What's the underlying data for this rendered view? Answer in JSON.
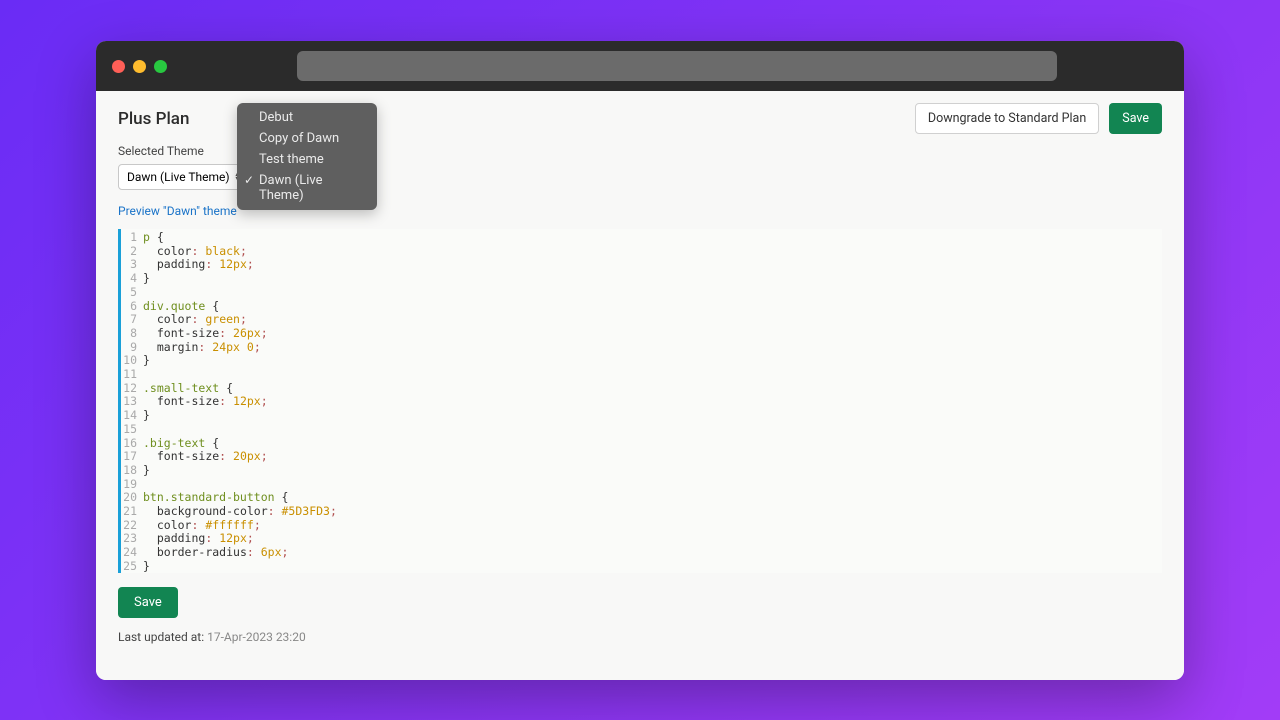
{
  "header": {
    "plan_title": "Plus Plan",
    "downgrade_label": "Downgrade to Standard Plan",
    "save_label": "Save"
  },
  "theme_picker": {
    "label": "Selected Theme",
    "selected": "Dawn (Live Theme)",
    "options": [
      "Debut",
      "Copy of Dawn",
      "Test theme",
      "Dawn (Live Theme)"
    ],
    "selected_index": 3
  },
  "preview_link": "Preview \"Dawn\" theme",
  "code": [
    {
      "n": 1,
      "t": [
        {
          "c": "tok-sel",
          "s": "p"
        },
        {
          "c": "",
          "s": " "
        },
        {
          "c": "tok-brace",
          "s": "{"
        }
      ]
    },
    {
      "n": 2,
      "t": [
        {
          "c": "",
          "s": "  "
        },
        {
          "c": "tok-prop",
          "s": "color"
        },
        {
          "c": "tok-punc",
          "s": ": "
        },
        {
          "c": "tok-val",
          "s": "black"
        },
        {
          "c": "tok-punc",
          "s": ";"
        }
      ]
    },
    {
      "n": 3,
      "t": [
        {
          "c": "",
          "s": "  "
        },
        {
          "c": "tok-prop",
          "s": "padding"
        },
        {
          "c": "tok-punc",
          "s": ": "
        },
        {
          "c": "tok-val",
          "s": "12px"
        },
        {
          "c": "tok-punc",
          "s": ";"
        }
      ]
    },
    {
      "n": 4,
      "t": [
        {
          "c": "tok-brace",
          "s": "}"
        }
      ]
    },
    {
      "n": 5,
      "t": []
    },
    {
      "n": 6,
      "t": [
        {
          "c": "tok-sel",
          "s": "div.quote"
        },
        {
          "c": "",
          "s": " "
        },
        {
          "c": "tok-brace",
          "s": "{"
        }
      ]
    },
    {
      "n": 7,
      "t": [
        {
          "c": "",
          "s": "  "
        },
        {
          "c": "tok-prop",
          "s": "color"
        },
        {
          "c": "tok-punc",
          "s": ": "
        },
        {
          "c": "tok-val",
          "s": "green"
        },
        {
          "c": "tok-punc",
          "s": ";"
        }
      ]
    },
    {
      "n": 8,
      "t": [
        {
          "c": "",
          "s": "  "
        },
        {
          "c": "tok-prop",
          "s": "font-size"
        },
        {
          "c": "tok-punc",
          "s": ": "
        },
        {
          "c": "tok-val",
          "s": "26px"
        },
        {
          "c": "tok-punc",
          "s": ";"
        }
      ]
    },
    {
      "n": 9,
      "t": [
        {
          "c": "",
          "s": "  "
        },
        {
          "c": "tok-prop",
          "s": "margin"
        },
        {
          "c": "tok-punc",
          "s": ": "
        },
        {
          "c": "tok-val",
          "s": "24px 0"
        },
        {
          "c": "tok-punc",
          "s": ";"
        }
      ]
    },
    {
      "n": 10,
      "t": [
        {
          "c": "tok-brace",
          "s": "}"
        }
      ]
    },
    {
      "n": 11,
      "t": []
    },
    {
      "n": 12,
      "t": [
        {
          "c": "tok-sel",
          "s": ".small-text"
        },
        {
          "c": "",
          "s": " "
        },
        {
          "c": "tok-brace",
          "s": "{"
        }
      ]
    },
    {
      "n": 13,
      "t": [
        {
          "c": "",
          "s": "  "
        },
        {
          "c": "tok-prop",
          "s": "font-size"
        },
        {
          "c": "tok-punc",
          "s": ": "
        },
        {
          "c": "tok-val",
          "s": "12px"
        },
        {
          "c": "tok-punc",
          "s": ";"
        }
      ]
    },
    {
      "n": 14,
      "t": [
        {
          "c": "tok-brace",
          "s": "}"
        }
      ]
    },
    {
      "n": 15,
      "t": []
    },
    {
      "n": 16,
      "t": [
        {
          "c": "tok-sel",
          "s": ".big-text"
        },
        {
          "c": "",
          "s": " "
        },
        {
          "c": "tok-brace",
          "s": "{"
        }
      ]
    },
    {
      "n": 17,
      "t": [
        {
          "c": "",
          "s": "  "
        },
        {
          "c": "tok-prop",
          "s": "font-size"
        },
        {
          "c": "tok-punc",
          "s": ": "
        },
        {
          "c": "tok-val",
          "s": "20px"
        },
        {
          "c": "tok-punc",
          "s": ";"
        }
      ]
    },
    {
      "n": 18,
      "t": [
        {
          "c": "tok-brace",
          "s": "}"
        }
      ]
    },
    {
      "n": 19,
      "t": []
    },
    {
      "n": 20,
      "t": [
        {
          "c": "tok-sel",
          "s": "btn.standard-button"
        },
        {
          "c": "",
          "s": " "
        },
        {
          "c": "tok-brace",
          "s": "{"
        }
      ]
    },
    {
      "n": 21,
      "t": [
        {
          "c": "",
          "s": "  "
        },
        {
          "c": "tok-prop",
          "s": "background-color"
        },
        {
          "c": "tok-punc",
          "s": ": "
        },
        {
          "c": "tok-val",
          "s": "#5D3FD3"
        },
        {
          "c": "tok-punc",
          "s": ";"
        }
      ]
    },
    {
      "n": 22,
      "t": [
        {
          "c": "",
          "s": "  "
        },
        {
          "c": "tok-prop",
          "s": "color"
        },
        {
          "c": "tok-punc",
          "s": ": "
        },
        {
          "c": "tok-val",
          "s": "#ffffff"
        },
        {
          "c": "tok-punc",
          "s": ";"
        }
      ]
    },
    {
      "n": 23,
      "t": [
        {
          "c": "",
          "s": "  "
        },
        {
          "c": "tok-prop",
          "s": "padding"
        },
        {
          "c": "tok-punc",
          "s": ": "
        },
        {
          "c": "tok-val",
          "s": "12px"
        },
        {
          "c": "tok-punc",
          "s": ";"
        }
      ]
    },
    {
      "n": 24,
      "t": [
        {
          "c": "",
          "s": "  "
        },
        {
          "c": "tok-prop",
          "s": "border-radius"
        },
        {
          "c": "tok-punc",
          "s": ": "
        },
        {
          "c": "tok-val",
          "s": "6px"
        },
        {
          "c": "tok-punc",
          "s": ";"
        }
      ]
    },
    {
      "n": 25,
      "t": [
        {
          "c": "tok-brace",
          "s": "}"
        }
      ]
    }
  ],
  "footer": {
    "save_label": "Save",
    "last_updated_prefix": "Last updated at: ",
    "last_updated_value": "17-Apr-2023 23:20"
  },
  "colors": {
    "accent_green": "#128552",
    "link_blue": "#1a73c8"
  }
}
